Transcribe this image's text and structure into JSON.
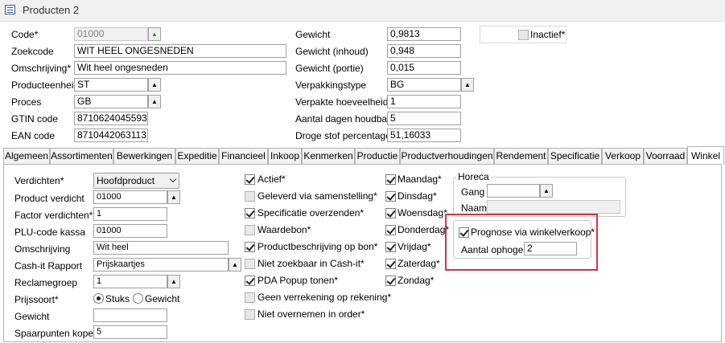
{
  "window": {
    "title": "Producten 2",
    "icon": "table-icon"
  },
  "header": {
    "left": [
      {
        "label": "Code*",
        "value": "01000",
        "disabled": true
      },
      {
        "label": "Zoekcode",
        "value": "WIT HEEL ONGESNEDEN"
      },
      {
        "label": "Omschrijving*",
        "value": "Wit heel ongesneden"
      },
      {
        "label": "Producteenheid",
        "value": "ST"
      },
      {
        "label": "Proces",
        "value": "GB"
      },
      {
        "label": "GTIN code",
        "value": "8710624045593"
      },
      {
        "label": "EAN code",
        "value": "8710442063113"
      }
    ],
    "right": [
      {
        "label": "Gewicht",
        "value": "0,9813"
      },
      {
        "label": "Gewicht (inhoud)",
        "value": "0,948"
      },
      {
        "label": "Gewicht (portie)",
        "value": "0,015"
      },
      {
        "label": "Verpakkingstype",
        "value": "BG"
      },
      {
        "label": "Verpakte hoeveelheid",
        "value": "1"
      },
      {
        "label": "Aantal dagen houdbaar",
        "value": "5"
      },
      {
        "label": "Droge stof percentage",
        "value": "51,16033"
      }
    ],
    "inactief": {
      "label": "Inactief*",
      "checked": false
    }
  },
  "tabs": [
    {
      "label": "Algemeen"
    },
    {
      "label": "Assortimenten"
    },
    {
      "label": "Bewerkingen"
    },
    {
      "label": "Expeditie"
    },
    {
      "label": "Financieel"
    },
    {
      "label": "Inkoop"
    },
    {
      "label": "Kenmerken"
    },
    {
      "label": "Productie"
    },
    {
      "label": "Productverhoudingen"
    },
    {
      "label": "Rendement"
    },
    {
      "label": "Specificatie"
    },
    {
      "label": "Verkoop"
    },
    {
      "label": "Voorraad"
    },
    {
      "label": "Winkel",
      "active": true
    }
  ],
  "winkel": {
    "fields": [
      {
        "label": "Verdichten*",
        "value": "Hoofdproduct"
      },
      {
        "label": "Product verdicht",
        "value": "01000"
      },
      {
        "label": "Factor verdichten*",
        "value": "1"
      },
      {
        "label": "PLU-code kassa",
        "value": "01000"
      },
      {
        "label": "Omschrijving",
        "value": "Wit heel"
      },
      {
        "label": "Cash-it Rapport",
        "value": "Prijskaartjes"
      },
      {
        "label": "Reclamegroep",
        "value": "1"
      },
      {
        "label": "Prijssoort*",
        "value": ""
      },
      {
        "label": "Gewicht",
        "value": ""
      },
      {
        "label": "Spaarpunten kopen",
        "value": "5"
      }
    ],
    "prijssoort_options": [
      {
        "label": "Stuks",
        "selected": true
      },
      {
        "label": "Gewicht",
        "selected": false
      }
    ],
    "checks_mid": [
      {
        "label": "Actief*",
        "checked": true
      },
      {
        "label": "Geleverd via samenstelling*",
        "checked": false
      },
      {
        "label": "Specificatie overzenden*",
        "checked": true
      },
      {
        "label": "Waardebon*",
        "checked": false
      },
      {
        "label": "Productbeschrijving op bon*",
        "checked": true
      },
      {
        "label": "Niet zoekbaar in Cash-it*",
        "checked": false
      },
      {
        "label": "PDA Popup tonen*",
        "checked": true
      },
      {
        "label": "Geen verrekening op rekening*",
        "checked": false
      },
      {
        "label": "Niet overnemen in order*",
        "checked": false
      }
    ],
    "days": [
      {
        "label": "Maandag*",
        "checked": true
      },
      {
        "label": "Dinsdag*",
        "checked": true
      },
      {
        "label": "Woensdag*",
        "checked": true
      },
      {
        "label": "Donderdag*",
        "checked": true
      },
      {
        "label": "Vrijdag*",
        "checked": true
      },
      {
        "label": "Zaterdag*",
        "checked": true
      },
      {
        "label": "Zondag*",
        "checked": true
      }
    ],
    "horeca": {
      "title": "Horeca",
      "gang_label": "Gang",
      "gang_value": "",
      "naam_label": "Naam",
      "naam_value": ""
    },
    "prognose": {
      "label": "Prognose via winkelverkoop*",
      "checked": true,
      "ophogen_label": "Aantal ophogen",
      "ophogen_value": "2"
    }
  },
  "colors": {
    "highlight": "#e0303a",
    "accent": "#20a020"
  }
}
